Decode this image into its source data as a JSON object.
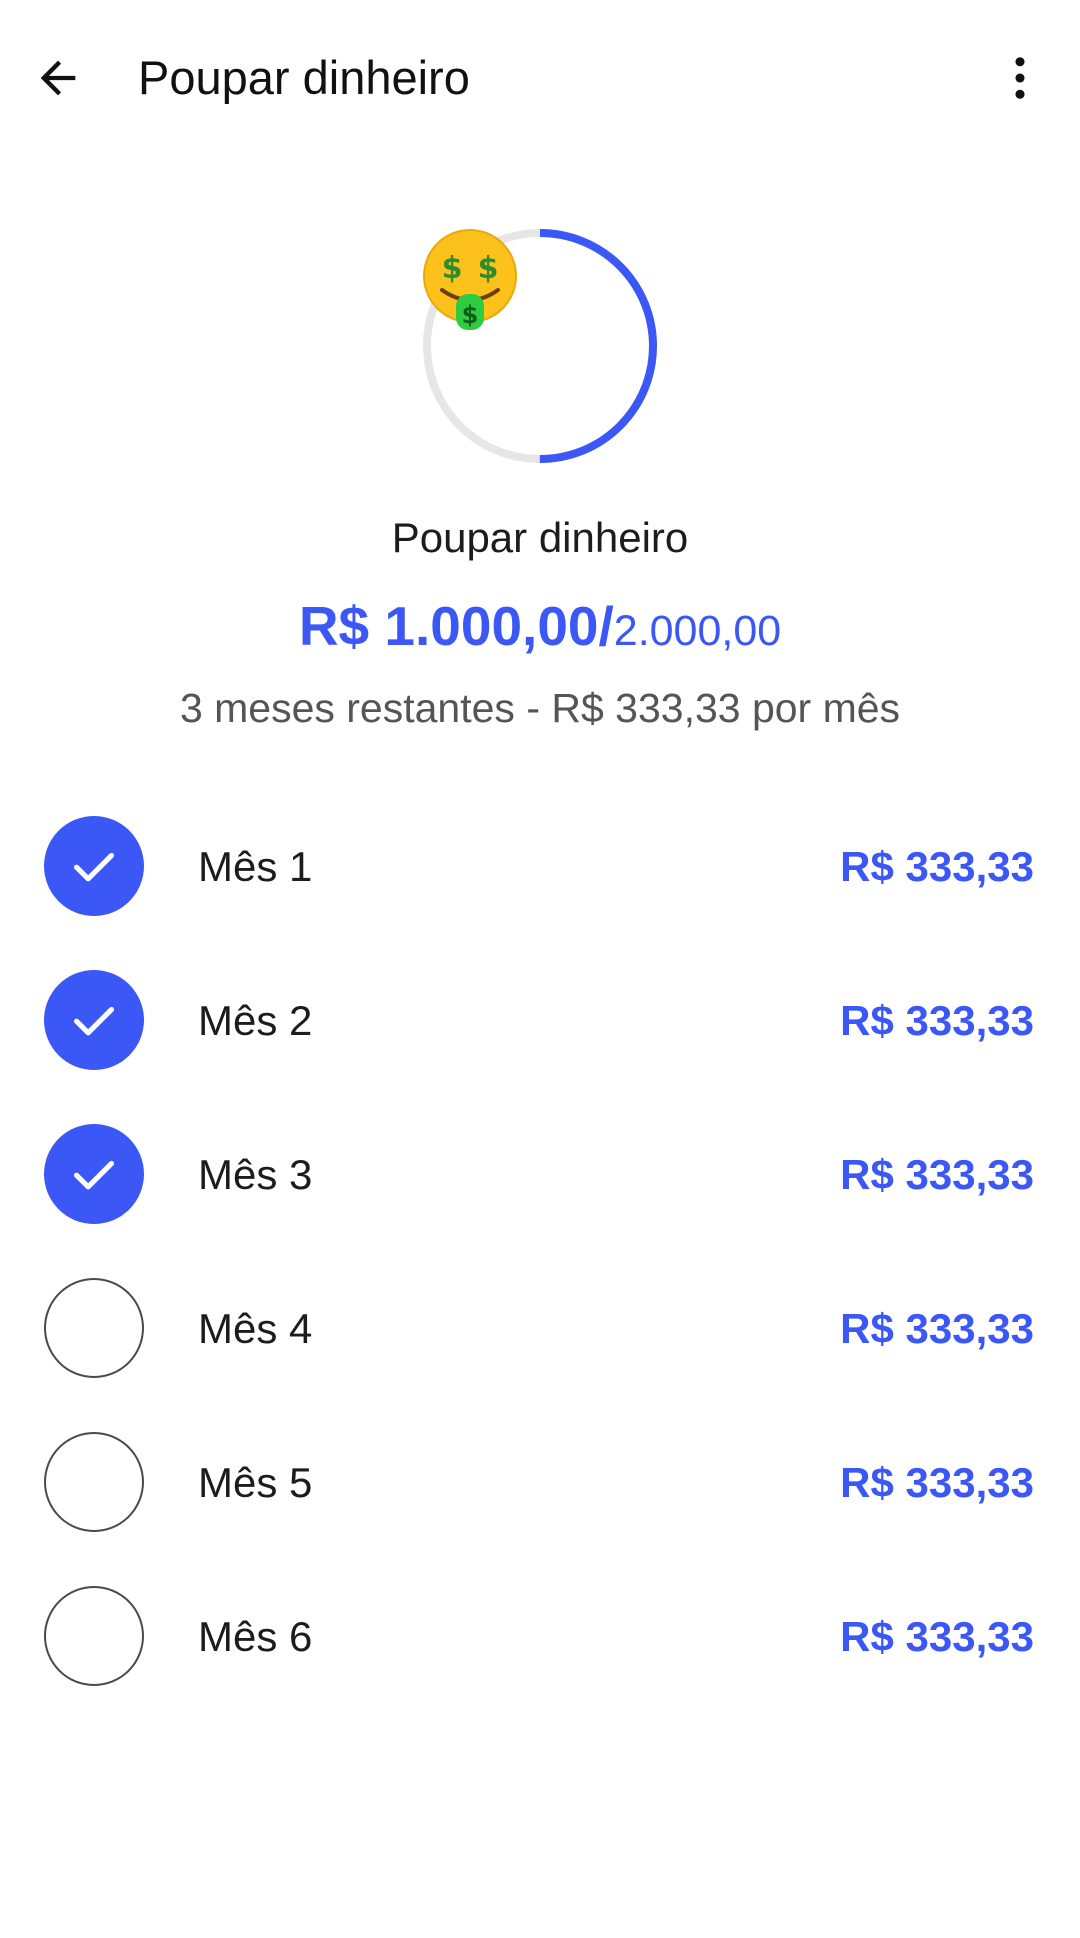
{
  "appbar": {
    "title": "Poupar dinheiro",
    "back_icon": "arrow-back-icon",
    "menu_icon": "more-vert-icon"
  },
  "goal": {
    "icon": "money-mouth-face-emoji",
    "name": "Poupar dinheiro",
    "amount_current": "R$ 1.000,00",
    "amount_separator": "/",
    "amount_target": "2.000,00",
    "progress_fraction": 0.5,
    "remaining_text": "3 meses restantes - R$ 333,33 por mês"
  },
  "months": [
    {
      "label": "Mês 1",
      "amount": "R$ 333,33",
      "paid": true
    },
    {
      "label": "Mês 2",
      "amount": "R$ 333,33",
      "paid": true
    },
    {
      "label": "Mês 3",
      "amount": "R$ 333,33",
      "paid": true
    },
    {
      "label": "Mês 4",
      "amount": "R$ 333,33",
      "paid": false
    },
    {
      "label": "Mês 5",
      "amount": "R$ 333,33",
      "paid": false
    },
    {
      "label": "Mês 6",
      "amount": "R$ 333,33",
      "paid": false
    }
  ],
  "colors": {
    "accent": "#3b57f5",
    "ring_track": "#e6e6e6",
    "unchecked_border": "#4a4a4a",
    "secondary_text": "#555555"
  }
}
